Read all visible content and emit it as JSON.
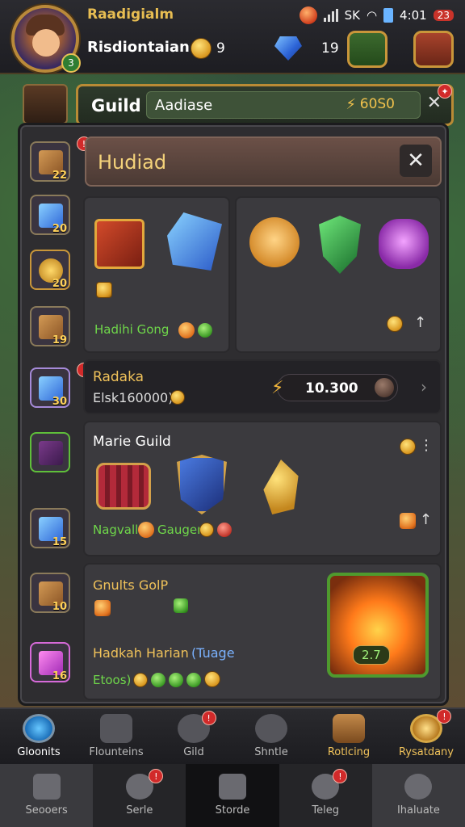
{
  "status": {
    "time": "4:01",
    "network": "SK",
    "battery_badge": "23"
  },
  "player": {
    "title": "Raadigialm",
    "name": "Risdiontaian",
    "level": "3"
  },
  "resources": {
    "gold": "9",
    "gems": "19"
  },
  "guild_bar": {
    "label": "Guild",
    "field_value": "Aadiase",
    "gold": "60S0"
  },
  "panel": {
    "header_title": "Hudiad",
    "close_label": "✕",
    "item_card_caption": "Hadihi Gong",
    "rank_card": {
      "title": "Radaka",
      "subtitle": "Elsk160000)",
      "progress_value": "10.300"
    },
    "marie_guild": {
      "title": "Marie Guild",
      "caption_a": "Nagvall",
      "caption_b": "Gaugen"
    },
    "bottom_card": {
      "title": "Gnults GolP",
      "line2_a": "Hadkah Harian",
      "line2_b": "(Tuage",
      "line3": "Etoos)",
      "fire_count": "2.7"
    }
  },
  "side_slots": [
    {
      "count": "22",
      "icon": "wood"
    },
    {
      "count": "20",
      "icon": "blue"
    },
    {
      "count": "20",
      "icon": "gold"
    },
    {
      "count": "19",
      "icon": "wood"
    },
    {
      "count": "30",
      "icon": "blue"
    },
    {
      "count": "",
      "icon": "purple"
    },
    {
      "count": "15",
      "icon": "blue"
    },
    {
      "count": "10",
      "icon": "wood"
    },
    {
      "count": "16",
      "icon": "pink"
    }
  ],
  "nav_primary": [
    {
      "label": "Gloonits"
    },
    {
      "label": "Flounteins"
    },
    {
      "label": "Gild"
    },
    {
      "label": "Shntle"
    },
    {
      "label": "Rotlcing"
    },
    {
      "label": "Rysatdany"
    }
  ],
  "nav_secondary": [
    {
      "label": "Seooers"
    },
    {
      "label": "Serle"
    },
    {
      "label": "Storde"
    },
    {
      "label": "Teleg"
    },
    {
      "label": "Ihaluate"
    }
  ],
  "colors": {
    "accent_gold": "#e7bd52",
    "panel": "#2e2d30",
    "green_text": "#6fd74a"
  }
}
